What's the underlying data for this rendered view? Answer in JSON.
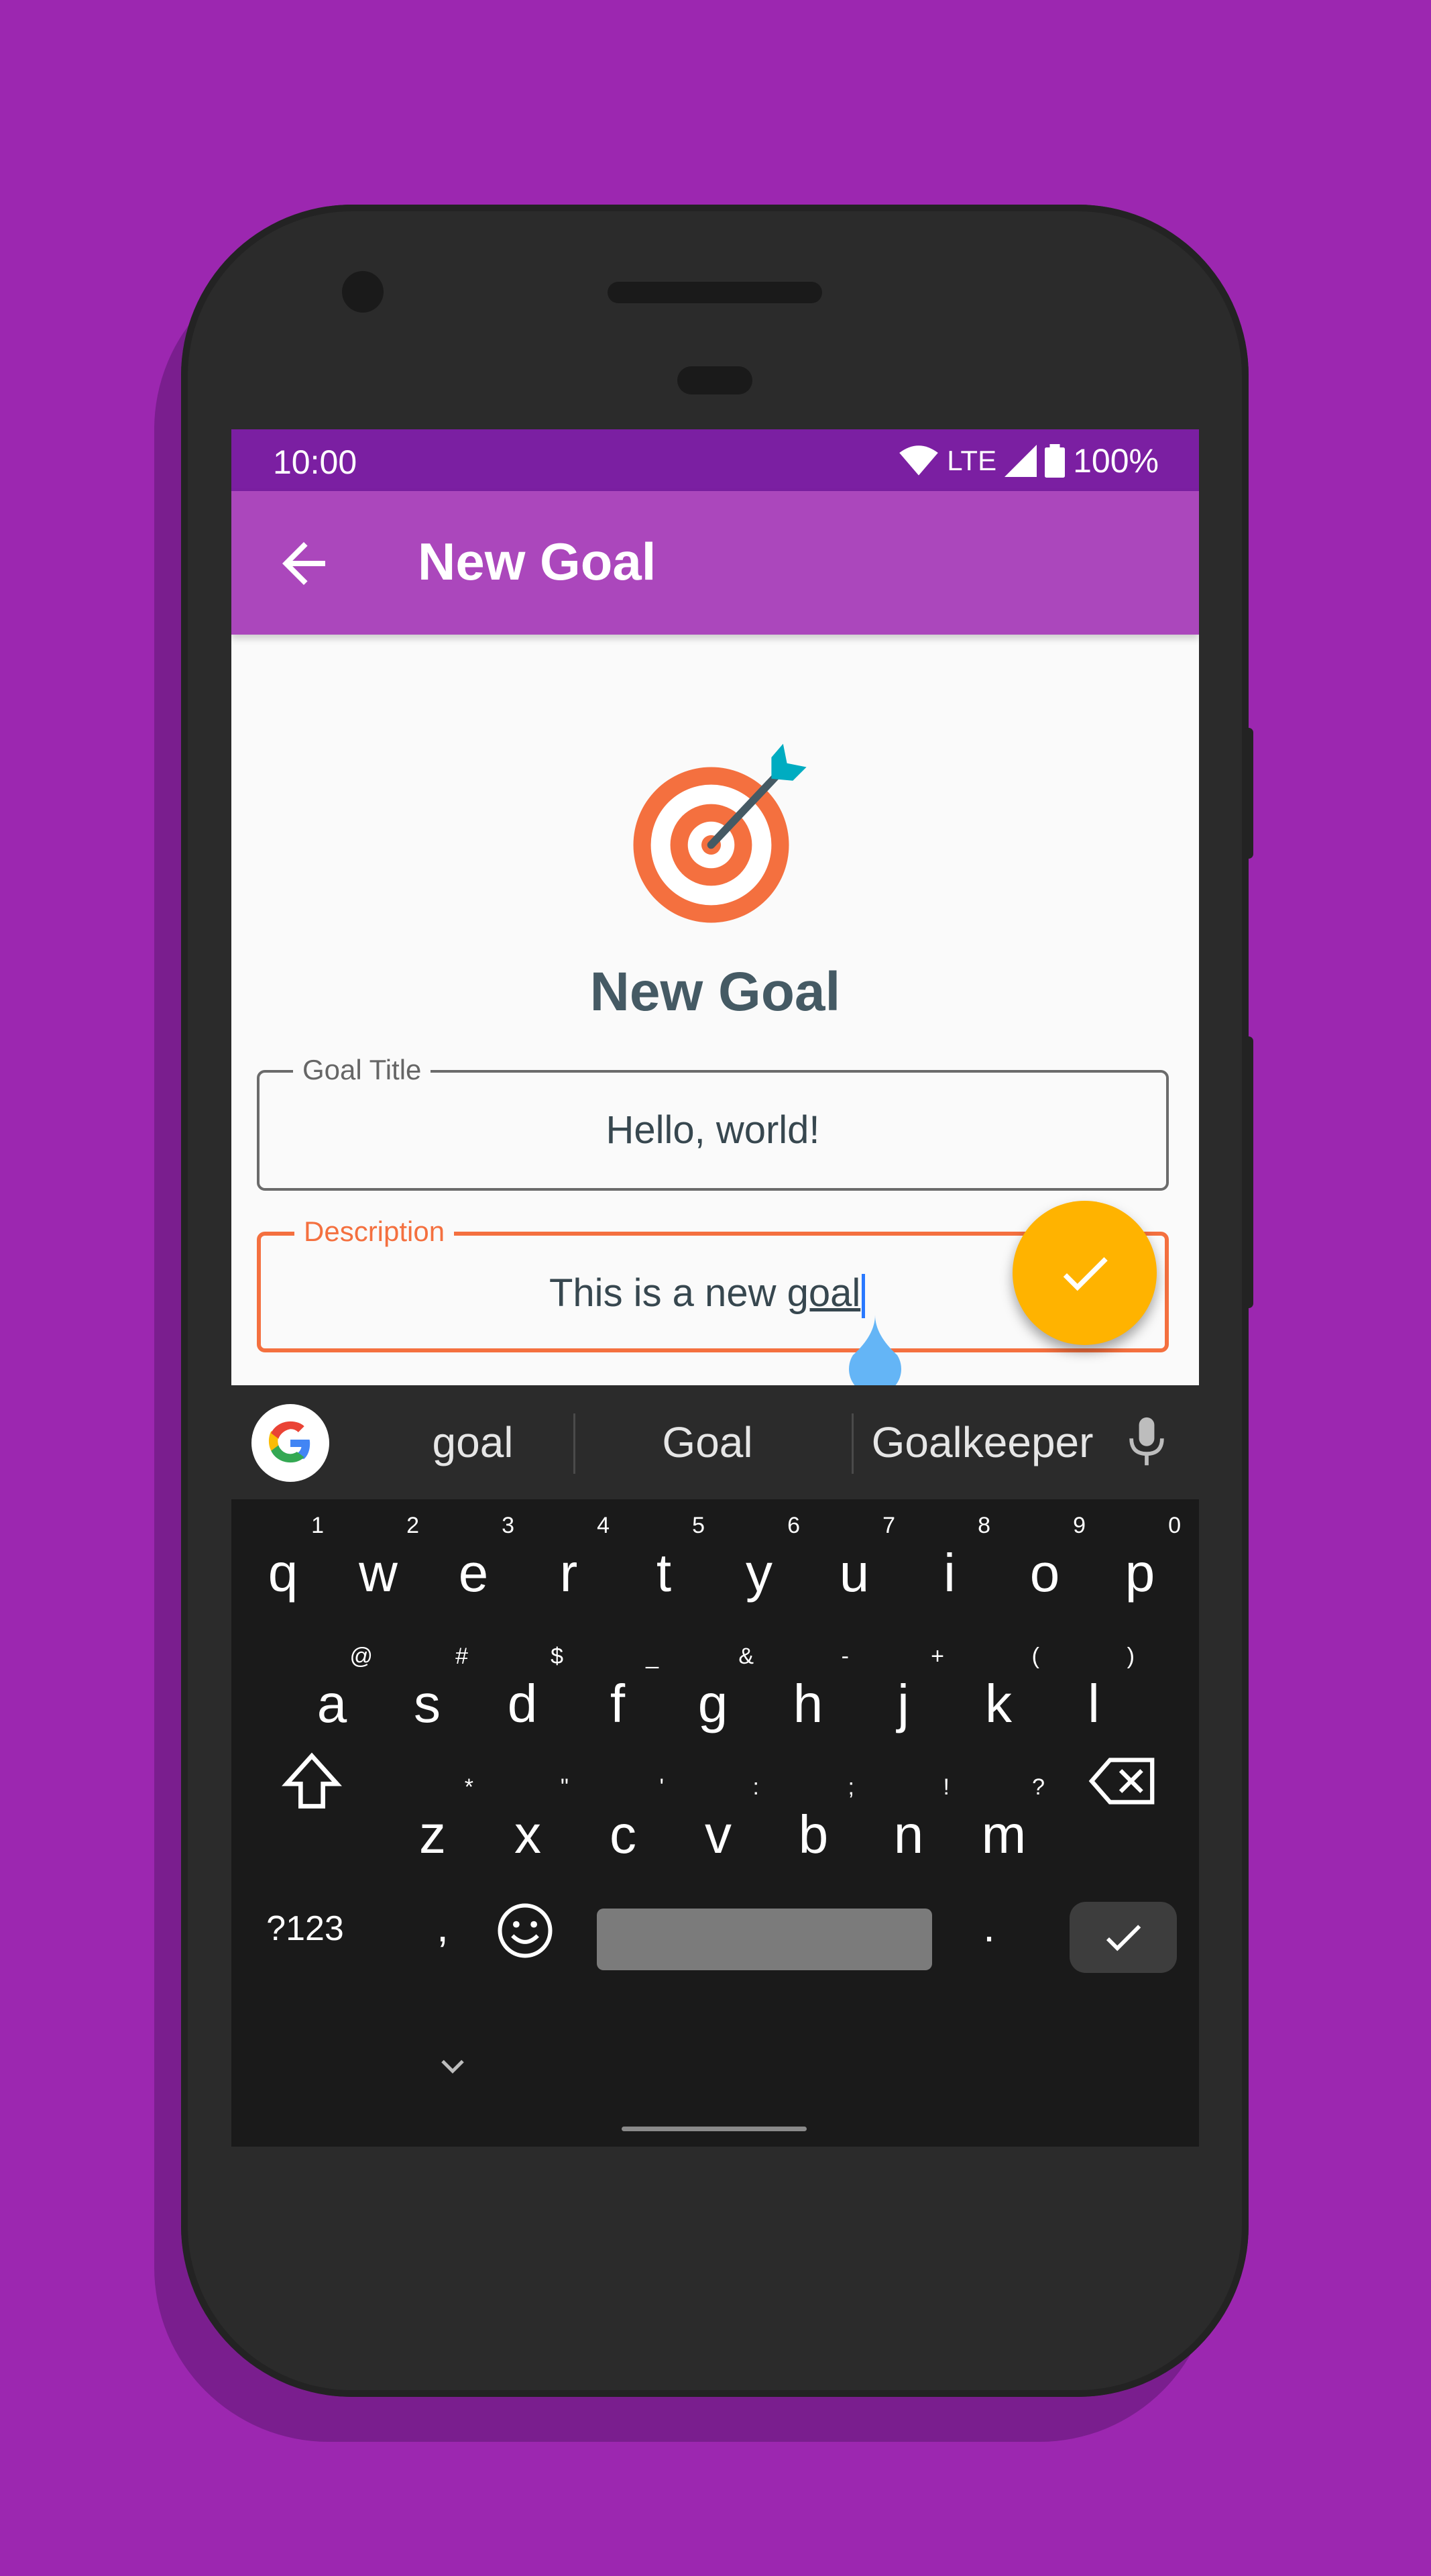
{
  "status_bar": {
    "time": "10:00",
    "network": "LTE",
    "battery": "100%"
  },
  "app_bar": {
    "title": "New Goal",
    "back_icon": "arrow-back-icon"
  },
  "form": {
    "heading": "New Goal",
    "goal_title": {
      "label": "Goal Title",
      "value": "Hello, world!"
    },
    "description": {
      "label": "Description",
      "value_prefix": "This is a new ",
      "value_word": "goal"
    }
  },
  "fab": {
    "icon": "check-icon",
    "color": "#ffb300"
  },
  "keyboard": {
    "suggestions": [
      "goal",
      "Goal",
      "Goalkeeper"
    ],
    "rows": [
      [
        {
          "k": "q",
          "s": "1"
        },
        {
          "k": "w",
          "s": "2"
        },
        {
          "k": "e",
          "s": "3"
        },
        {
          "k": "r",
          "s": "4"
        },
        {
          "k": "t",
          "s": "5"
        },
        {
          "k": "y",
          "s": "6"
        },
        {
          "k": "u",
          "s": "7"
        },
        {
          "k": "i",
          "s": "8"
        },
        {
          "k": "o",
          "s": "9"
        },
        {
          "k": "p",
          "s": "0"
        }
      ],
      [
        {
          "k": "a",
          "s": "@"
        },
        {
          "k": "s",
          "s": "#"
        },
        {
          "k": "d",
          "s": "$"
        },
        {
          "k": "f",
          "s": "_"
        },
        {
          "k": "g",
          "s": "&"
        },
        {
          "k": "h",
          "s": "-"
        },
        {
          "k": "j",
          "s": "+"
        },
        {
          "k": "k",
          "s": "("
        },
        {
          "k": "l",
          "s": ")"
        }
      ],
      [
        {
          "k": "z",
          "s": "*"
        },
        {
          "k": "x",
          "s": "\""
        },
        {
          "k": "c",
          "s": "'"
        },
        {
          "k": "v",
          "s": ":"
        },
        {
          "k": "b",
          "s": ";"
        },
        {
          "k": "n",
          "s": "!"
        },
        {
          "k": "m",
          "s": "?"
        }
      ]
    ],
    "symbols_label": "?123",
    "comma": ",",
    "period": "."
  },
  "colors": {
    "background": "#9c27b0",
    "app_bar": "#ab47bc",
    "status_bar": "#7b1fa2",
    "accent": "#f4703f"
  }
}
